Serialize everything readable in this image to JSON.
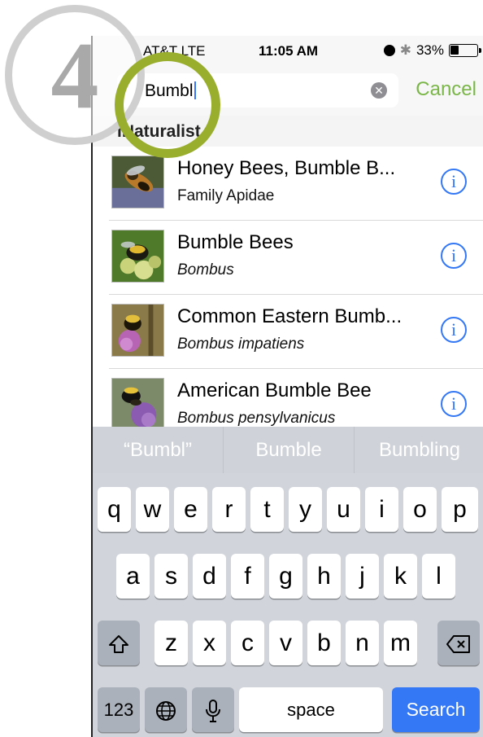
{
  "status_bar": {
    "carrier": "AT&T LTE",
    "time": "11:05 AM",
    "battery": "33%",
    "battery_level": 0.33
  },
  "search": {
    "value": "Bumbl",
    "cancel_label": "Cancel"
  },
  "section_header": "iNaturalist",
  "results": [
    {
      "title": "Honey Bees, Bumble B...",
      "subtitle": "Family Apidae",
      "italic": false
    },
    {
      "title": "Bumble Bees",
      "subtitle": "Bombus",
      "italic": true
    },
    {
      "title": "Common Eastern Bumb...",
      "subtitle": "Bombus impatiens",
      "italic": true
    },
    {
      "title": "American Bumble Bee",
      "subtitle": "Bombus pensylvanicus",
      "italic": true
    }
  ],
  "predictions": [
    "“Bumbl”",
    "Bumble",
    "Bumbling"
  ],
  "keyboard": {
    "row1": [
      "q",
      "w",
      "e",
      "r",
      "t",
      "y",
      "u",
      "i",
      "o",
      "p"
    ],
    "row2": [
      "a",
      "s",
      "d",
      "f",
      "g",
      "h",
      "j",
      "k",
      "l"
    ],
    "row3": [
      "z",
      "x",
      "c",
      "v",
      "b",
      "n",
      "m"
    ],
    "numbers_label": "123",
    "space_label": "space",
    "search_label": "Search"
  },
  "step_badge": "4",
  "colors": {
    "accent_green": "#7ab648",
    "ios_blue": "#3478f6",
    "highlight_olive": "#9aae2e",
    "badge_gray": "#cfcfcf"
  },
  "icons": {
    "clear": "clear-circle-icon",
    "info": "info-icon",
    "shift": "shift-icon",
    "delete": "backspace-icon",
    "globe": "globe-icon",
    "mic": "microphone-icon"
  }
}
